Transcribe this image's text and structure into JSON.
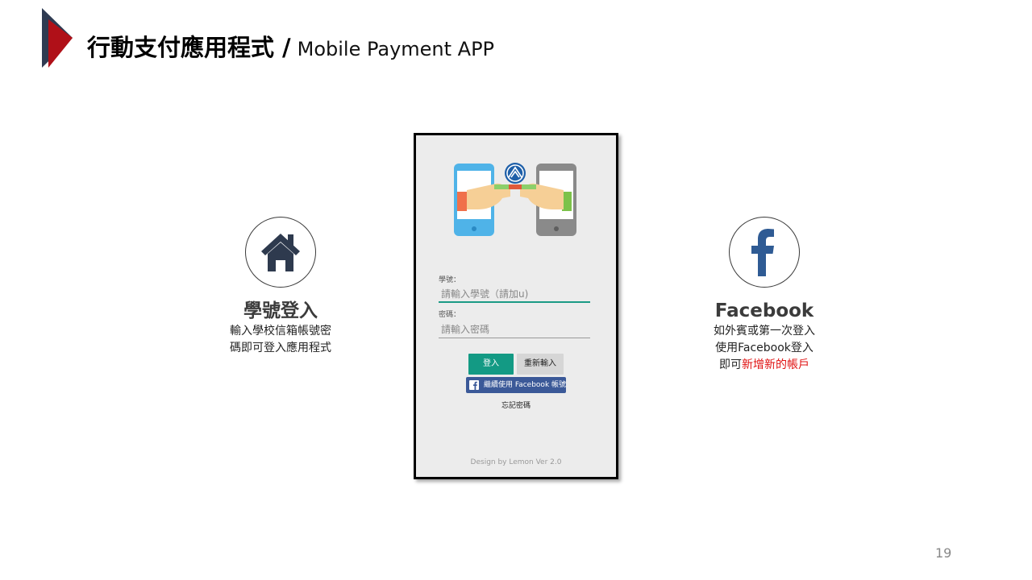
{
  "title": {
    "zh": "行動支付應用程式",
    "separator": "/",
    "en": "Mobile Payment APP"
  },
  "left_feature": {
    "icon": "home-icon",
    "title": "學號登入",
    "lines": [
      "輸入學校信箱帳號密",
      "碼即可登入應用程式"
    ]
  },
  "right_feature": {
    "icon": "facebook-icon",
    "title": "Facebook",
    "line1": "如外賓或第一次登入",
    "line2": "使用Facebook登入",
    "line3_prefix": "即可",
    "line3_highlight": "新增新的帳戶"
  },
  "app": {
    "student_id_label": "學號：",
    "student_id_placeholder": "請輸入學號（請加u)",
    "password_label": "密碼：",
    "password_placeholder": "請輸入密碼",
    "login_button": "登入",
    "reset_button": "重新輸入",
    "facebook_button": "繼續使用 Facebook 帳號",
    "forgot_password": "忘記密碼",
    "credit": "Design by Lemon Ver 2.0"
  },
  "page_number": "19",
  "colors": {
    "accent_teal": "#139a84",
    "facebook_blue": "#3b5998",
    "highlight_red": "#e01010",
    "icon_dark": "#2e3a4e"
  }
}
